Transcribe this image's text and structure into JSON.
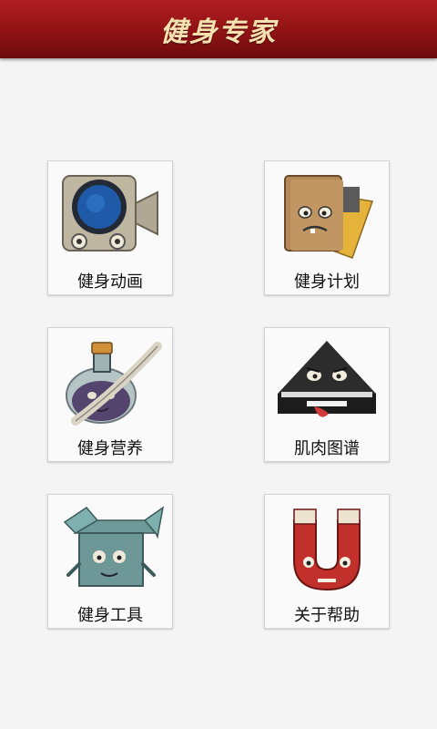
{
  "header": {
    "title": "健身专家"
  },
  "menu": {
    "items": [
      {
        "label": "健身动画",
        "icon": "camera-icon"
      },
      {
        "label": "健身计划",
        "icon": "notebook-icon"
      },
      {
        "label": "健身营养",
        "icon": "potion-icon"
      },
      {
        "label": "肌肉图谱",
        "icon": "triangle-monster-icon"
      },
      {
        "label": "健身工具",
        "icon": "box-icon"
      },
      {
        "label": "关于帮助",
        "icon": "magnet-icon"
      }
    ]
  }
}
